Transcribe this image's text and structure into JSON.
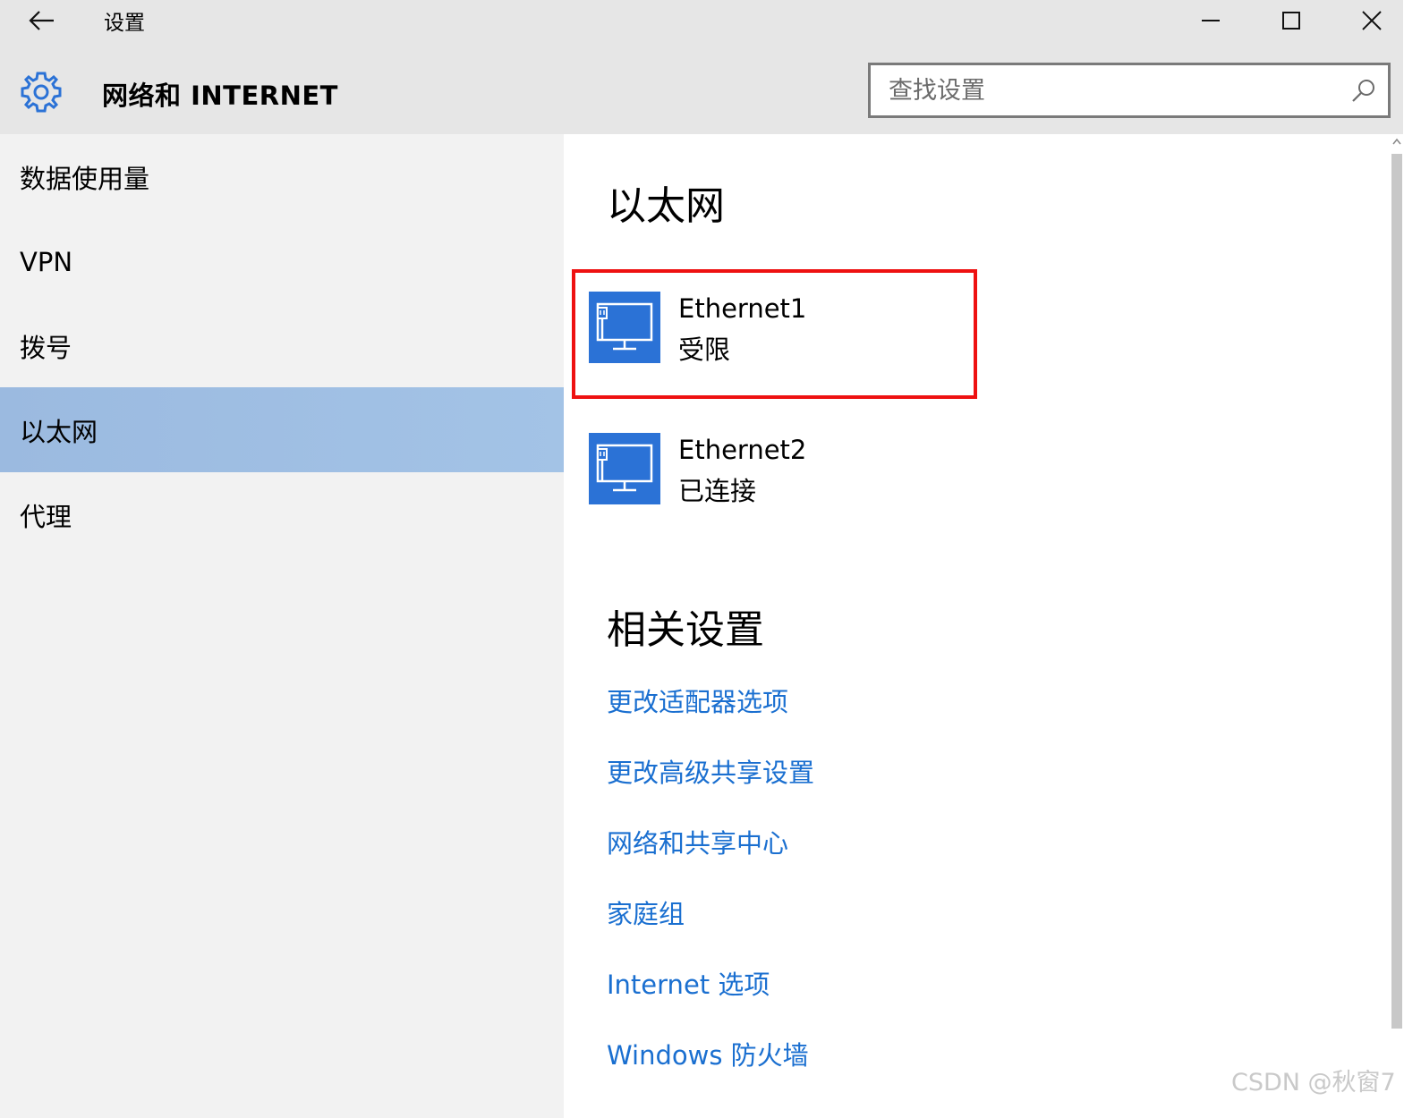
{
  "titlebar": {
    "back_icon": "arrow-left-icon",
    "title": "设置",
    "controls": [
      "minimize-icon",
      "maximize-icon",
      "close-icon"
    ]
  },
  "header": {
    "icon": "gear-icon",
    "title": "网络和 INTERNET",
    "search_placeholder": "查找设置",
    "search_value": "",
    "search_icon": "search-icon"
  },
  "sidebar": {
    "items": [
      {
        "label": "数据使用量",
        "selected": false
      },
      {
        "label": "VPN",
        "selected": false
      },
      {
        "label": "拨号",
        "selected": false
      },
      {
        "label": "以太网",
        "selected": true
      },
      {
        "label": "代理",
        "selected": false
      }
    ]
  },
  "main": {
    "heading": "以太网",
    "adapters": [
      {
        "name": "Ethernet1",
        "status": "受限",
        "icon": "monitor-network-icon",
        "highlighted": true
      },
      {
        "name": "Ethernet2",
        "status": "已连接",
        "icon": "monitor-network-icon",
        "highlighted": false
      }
    ],
    "related_heading": "相关设置",
    "related_links": [
      "更改适配器选项",
      "更改高级共享设置",
      "网络和共享中心",
      "家庭组",
      "Internet 选项",
      "Windows 防火墙"
    ]
  },
  "watermark": "CSDN @秋窗7",
  "colors": {
    "accent": "#2b72d6",
    "link": "#1a6fd0",
    "selected_nav": "#9fbfe4",
    "highlight_border": "#ee1111",
    "chrome": "#e6e6e6",
    "sidebar": "#f2f2f2"
  }
}
